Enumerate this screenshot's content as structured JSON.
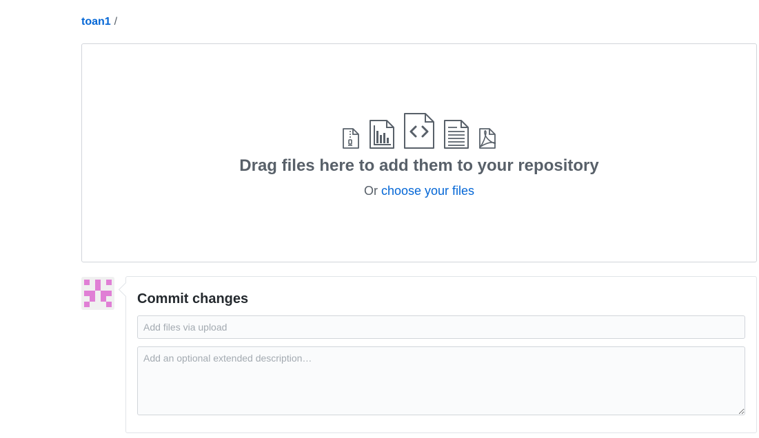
{
  "breadcrumb": {
    "owner": "toan1",
    "separator": "/"
  },
  "dropzone": {
    "icons": [
      "zip-file-icon",
      "graph-file-icon",
      "code-file-icon",
      "text-file-icon",
      "pdf-file-icon"
    ],
    "title": "Drag files here to add them to your repository",
    "sub_prefix": "Or",
    "choose_label": "choose your files"
  },
  "avatar": {
    "color": "#e07fd5"
  },
  "commit": {
    "title": "Commit changes",
    "summary_placeholder": "Add files via upload",
    "summary_value": "",
    "description_placeholder": "Add an optional extended description…",
    "description_value": ""
  },
  "colors": {
    "link": "#0366d6",
    "muted_text": "#586069",
    "border": "#d1d5da",
    "input_bg": "#fafbfc"
  }
}
